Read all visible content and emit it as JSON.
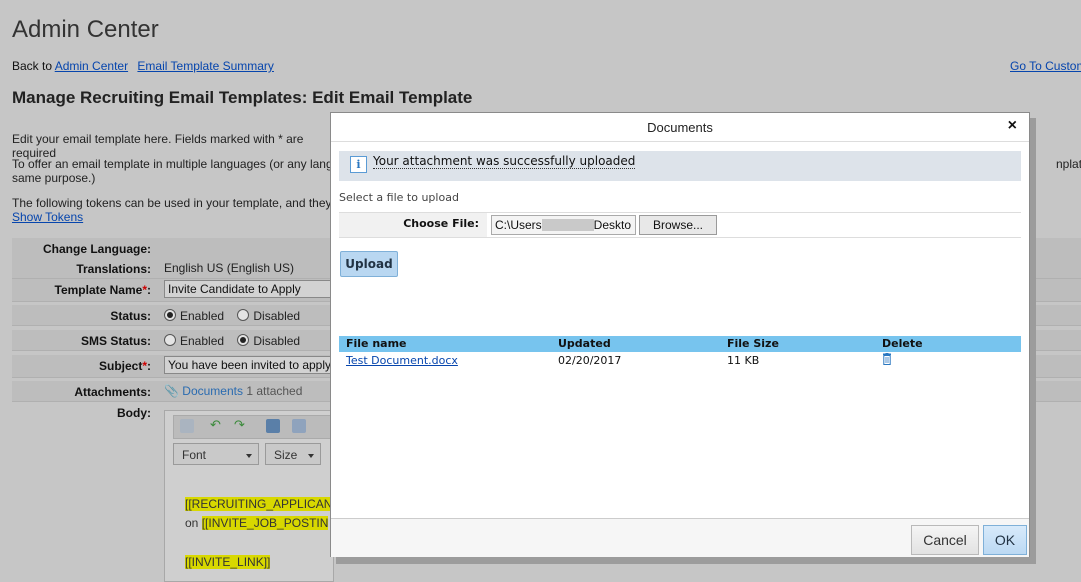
{
  "page": {
    "title": "Admin Center",
    "back_prefix": "Back to",
    "back_links": [
      "Admin Center",
      "Email Template Summary"
    ],
    "go_to_link": "Go To Custom",
    "section_title": "Manage Recruiting Email Templates: Edit Email Template",
    "intro": "Edit your email template here. Fields marked with * are required",
    "languages_text": "To offer an email template in multiple languages (or any languag",
    "languages_text_2": "same purpose.)",
    "languages_right": "nplates fo",
    "tokens_text": "The following tokens can be used in your template, and they will",
    "show_tokens": "Show Tokens"
  },
  "form": {
    "change_language_label": "Change Language:",
    "translations_label": "Translations:",
    "translations_value": "English US (English US)",
    "template_name_label": "Template Name",
    "template_name_value": "Invite Candidate to Apply",
    "status_label": "Status:",
    "sms_status_label": "SMS Status:",
    "enabled": "Enabled",
    "disabled": "Disabled",
    "subject_label": "Subject",
    "subject_value": "You have been invited to apply",
    "attachments_label": "Attachments:",
    "attachments_link": "Documents",
    "attachments_count": "1 attached",
    "body_label": "Body:",
    "required_mark": "*",
    "colon": ":"
  },
  "editor": {
    "font_label": "Font",
    "size_label": "Size",
    "token1": "[[RECRUITING_APPLICAN",
    "body_on": "on",
    "token2": "[[INVITE_JOB_POSTIN",
    "token3": "[[INVITE_LINK]]"
  },
  "modal": {
    "title": "Documents",
    "close": "×",
    "success_message": "Your attachment was successfully uploaded",
    "select_file_text": "Select a file to upload",
    "choose_file_label": "Choose File:",
    "file_path_prefix": "C:\\Users",
    "file_path_suffix": "Deskto",
    "browse_label": "Browse...",
    "upload_label": "Upload",
    "columns": [
      "File name",
      "Updated",
      "File Size",
      "Delete"
    ],
    "rows": [
      {
        "file_name": "Test Document.docx",
        "updated": "02/20/2017",
        "size": "11 KB"
      }
    ],
    "cancel_label": "Cancel",
    "ok_label": "OK"
  },
  "colors": {
    "backdrop": "#c6c6c6",
    "table_header": "#77c4ee",
    "link": "#0645ad",
    "token_highlight": "#d8d800"
  }
}
